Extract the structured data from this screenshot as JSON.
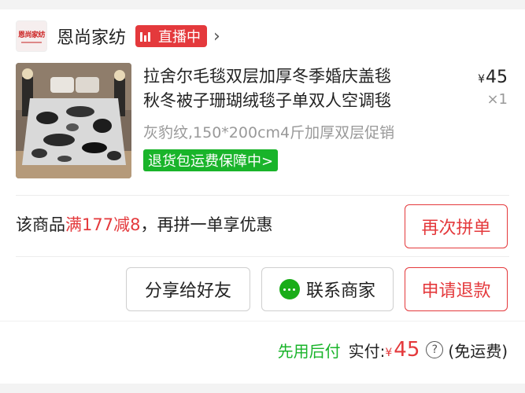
{
  "store": {
    "logo_text": "恩尚家纺",
    "name": "恩尚家纺",
    "live_label": "直播中"
  },
  "product": {
    "title_line1": "拉舍尔毛毯双层加厚冬季婚庆盖毯",
    "title_line2": "秋冬被子珊瑚绒毯子单双人空调毯",
    "price_currency": "¥",
    "price": "45",
    "quantity": "×1",
    "spec": "灰豹纹,150*200cm4斤加厚双层促销",
    "guarantee": "退货包运费保障中>"
  },
  "promo": {
    "prefix": "该商品",
    "highlight": "满177减8",
    "suffix": "，再拼一单享优惠",
    "rebuy_button": "再次拼单"
  },
  "actions": {
    "share": "分享给好友",
    "contact": "联系商家",
    "refund": "申请退款"
  },
  "payment": {
    "pay_later": "先用后付",
    "paid_label": "实付:",
    "currency": "¥",
    "amount": "45",
    "shipping": "(免运费)"
  },
  "colors": {
    "accent_red": "#e4393c",
    "green": "#19b42a"
  }
}
